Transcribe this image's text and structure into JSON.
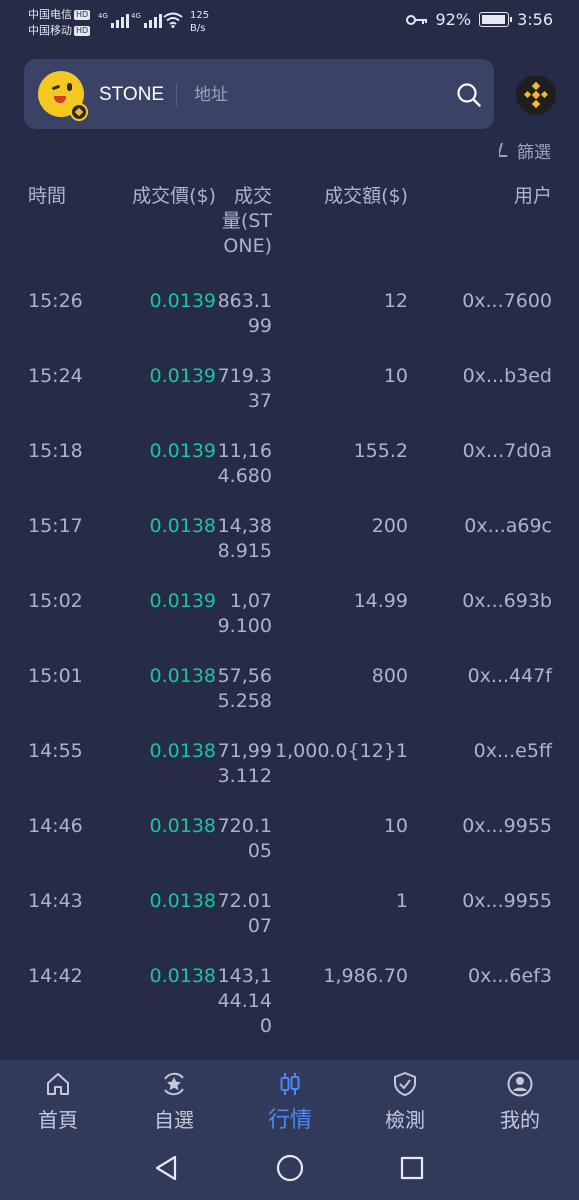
{
  "status_bar": {
    "carrier1": "中国电信",
    "carrier2": "中国移动",
    "hd": "HD",
    "net1": "4G",
    "net2": "4G",
    "speed_value": "125",
    "speed_unit": "B/s",
    "battery": "92%",
    "time": "3:56"
  },
  "header": {
    "token_name": "STONE",
    "address_placeholder": "地址",
    "search_icon": "search-icon",
    "chain_icon": "bnb-chain-icon"
  },
  "filter": {
    "label": "篩選"
  },
  "table": {
    "headers": {
      "time": "時間",
      "price": "成交價($)",
      "qty": "成交量(STONE)",
      "amount": "成交額($)",
      "user": "用户"
    },
    "rows": [
      {
        "time": "15:26",
        "price": "0.0139",
        "qty": "863.199",
        "amount": "12",
        "user": "0x...7600"
      },
      {
        "time": "15:24",
        "price": "0.0139",
        "qty": "719.337",
        "amount": "10",
        "user": "0x...b3ed"
      },
      {
        "time": "15:18",
        "price": "0.0139",
        "qty": "11,164.680",
        "amount": "155.2",
        "user": "0x...7d0a"
      },
      {
        "time": "15:17",
        "price": "0.0138",
        "qty": "14,388.915",
        "amount": "200",
        "user": "0x...a69c"
      },
      {
        "time": "15:02",
        "price": "0.0139",
        "qty": "1,079.100",
        "amount": "14.99",
        "user": "0x...693b"
      },
      {
        "time": "15:01",
        "price": "0.0138",
        "qty": "57,565.258",
        "amount": "800",
        "user": "0x...447f"
      },
      {
        "time": "14:55",
        "price": "0.0138",
        "qty": "71,993.112",
        "amount": "1,000.0{12}1",
        "user": "0x...e5ff"
      },
      {
        "time": "14:46",
        "price": "0.0138",
        "qty": "720.105",
        "amount": "10",
        "user": "0x...9955"
      },
      {
        "time": "14:43",
        "price": "0.0138",
        "qty": "72.0107",
        "amount": "1",
        "user": "0x...9955"
      },
      {
        "time": "14:42",
        "price": "0.0138",
        "qty": "143,144.140",
        "amount": "1,986.70",
        "user": "0x...6ef3"
      }
    ]
  },
  "bottom_nav": {
    "items": [
      {
        "label": "首頁",
        "icon": "home-icon",
        "active": false
      },
      {
        "label": "自選",
        "icon": "star-icon",
        "active": false
      },
      {
        "label": "行情",
        "icon": "candlestick-icon",
        "active": true
      },
      {
        "label": "檢測",
        "icon": "shield-check-icon",
        "active": false
      },
      {
        "label": "我的",
        "icon": "user-icon",
        "active": false
      }
    ]
  },
  "colors": {
    "background": "#262c48",
    "price_green": "#1fc29a",
    "active_blue": "#4f86f0",
    "text": "#aeb3c8"
  }
}
